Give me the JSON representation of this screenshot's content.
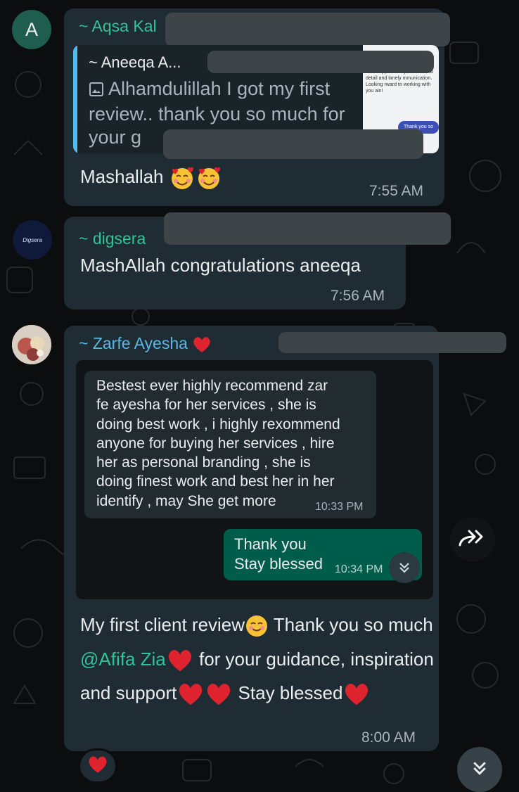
{
  "messages": {
    "aqsa": {
      "avatar_letter": "A",
      "sender": "~ Aqsa Kal",
      "quoted": {
        "name": "~ Aneeqa A...",
        "text": "Alhamdulillah I got my first review.. thank you so much for your g",
        "thumb_text": "aler. I appreciate your ention to detail and timely mmunication. Looking rward to working with you ain!",
        "thumb_button": "Thank you so"
      },
      "text": "Mashallah",
      "time": "7:55 AM"
    },
    "digsera": {
      "avatar_text": "Digsera",
      "sender": "~ digsera",
      "text": "MashAllah congratulations aneeqa",
      "time": "7:56 AM"
    },
    "zarfe": {
      "sender": "~ Zarfe Ayesha",
      "review_lines": [
        "Bestest ever highly recommend zar",
        "fe ayesha for her services , she is",
        "doing best work , i highly rexommend",
        "anyone for buying her services , hire",
        "her as personal branding , she is",
        "doing finest work and best her in her",
        "identify , may She get more"
      ],
      "review_time": "10:33 PM",
      "reply_lines": [
        "Thank you",
        "Stay blessed"
      ],
      "reply_time": "10:34 PM",
      "main": {
        "part1": "My first client review",
        "part2": " Thank you so much ",
        "mention": "@Afifa Zia",
        "part3": " for your guidance, inspiration and support",
        "part4": " Stay blessed"
      },
      "time": "8:00 AM"
    }
  },
  "icons": {
    "heart": "red-heart-emoji",
    "smiling_hearts": "smiling-face-with-hearts-emoji",
    "smile": "smiling-face-emoji",
    "forward": "forward-icon",
    "chevron": "double-chevron-down-icon"
  },
  "colors": {
    "background": "#0b0d0e",
    "incoming_bubble": "#202c33",
    "outgoing_bubble": "#005c4b",
    "sender_green": "#2fc39b",
    "sender_blue": "#58b6e4",
    "quote_bar": "#53bdeb",
    "heart": "#e0242f"
  }
}
